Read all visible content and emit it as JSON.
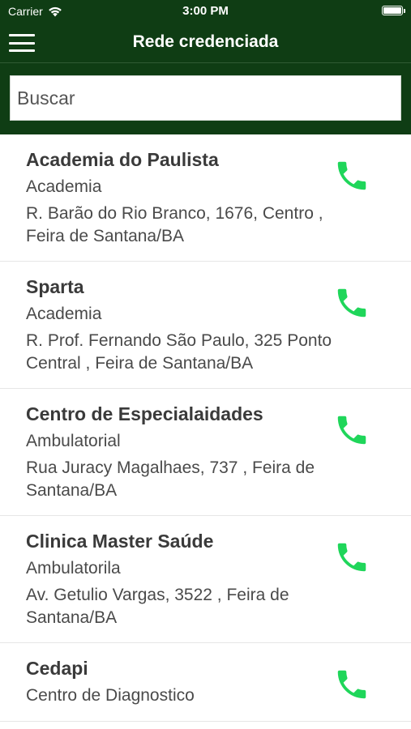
{
  "status_bar": {
    "carrier": "Carrier",
    "time": "3:00 PM"
  },
  "navbar": {
    "title": "Rede credenciada",
    "menu_icon": "hamburger-menu-icon"
  },
  "search": {
    "placeholder": "Buscar"
  },
  "colors": {
    "header_bg": "#0f3d14",
    "phone_icon": "#1fd65a"
  },
  "providers": [
    {
      "name": "Academia do Paulista",
      "category": "Academia",
      "address": "R. Barão do Rio Branco, 1676, Centro , Feira de Santana/BA"
    },
    {
      "name": "Sparta",
      "category": "Academia",
      "address": "R. Prof. Fernando São Paulo, 325 Ponto Central , Feira de Santana/BA"
    },
    {
      "name": "Centro de Especialaidades",
      "category": "Ambulatorial",
      "address": "Rua Juracy Magalhaes, 737 , Feira de Santana/BA"
    },
    {
      "name": "Clinica Master Saúde",
      "category": "Ambulatorila",
      "address": "Av. Getulio Vargas, 3522 , Feira de Santana/BA"
    },
    {
      "name": "Cedapi",
      "category": "Centro de Diagnostico",
      "address": ""
    }
  ]
}
